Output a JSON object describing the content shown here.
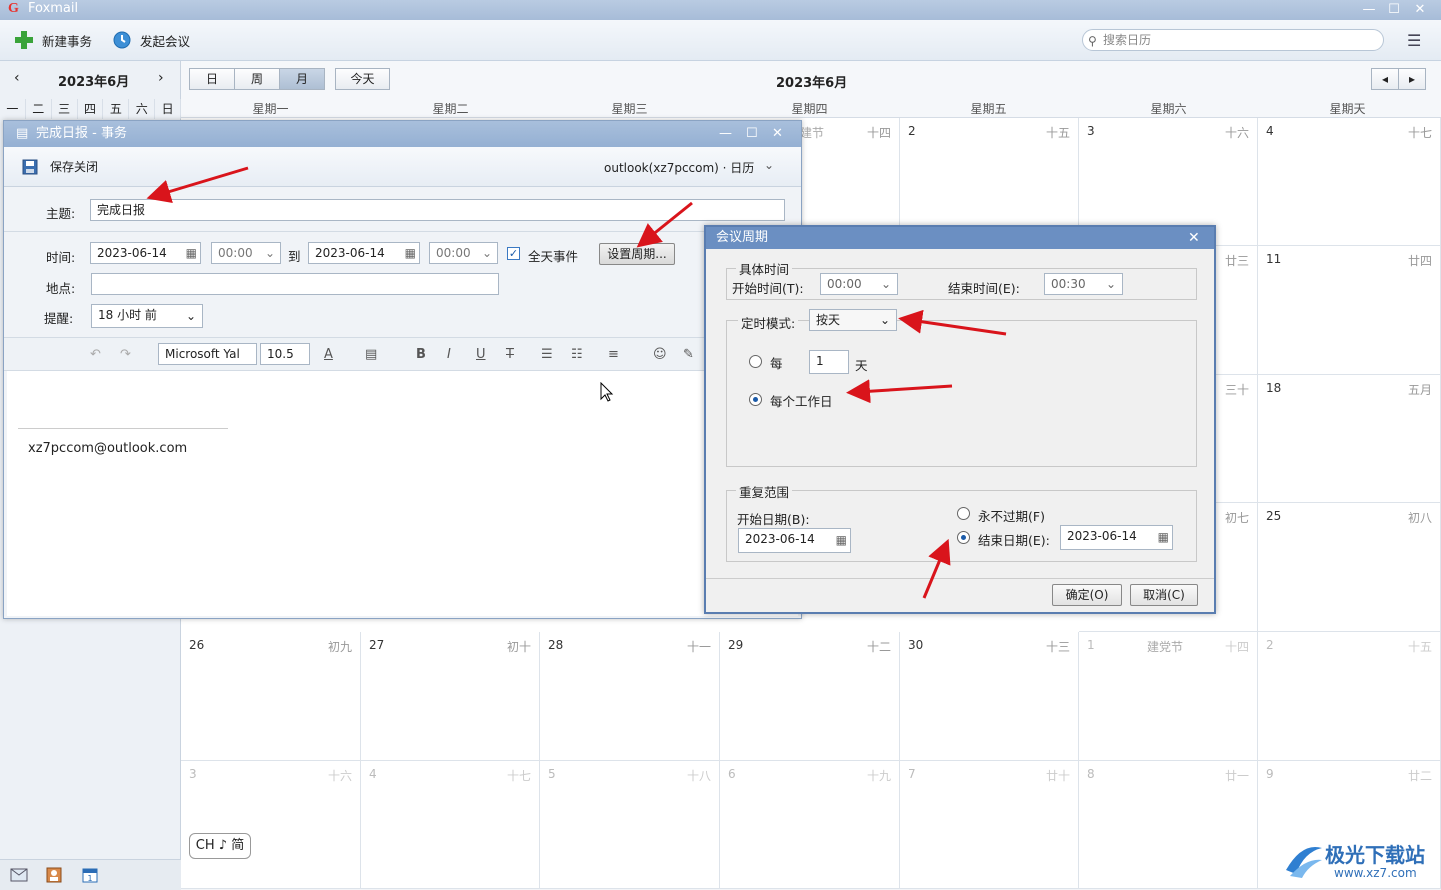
{
  "app": {
    "name": "Foxmail",
    "logo": "G"
  },
  "toolbar": {
    "new_event": "新建事务",
    "start_meeting": "发起会议",
    "search_placeholder": "搜索日历"
  },
  "sidebar": {
    "month": "2023年6月",
    "weekdays": [
      "一",
      "二",
      "三",
      "四",
      "五",
      "六",
      "日"
    ]
  },
  "view": {
    "day": "日",
    "week": "周",
    "month": "月",
    "today": "今天",
    "title": "2023年6月"
  },
  "dayheaders": [
    "星期一",
    "星期二",
    "星期三",
    "星期四",
    "星期五",
    "星期六",
    "星期天"
  ],
  "calendar": {
    "row0": [
      {
        "d": "",
        "l": "十四",
        "h": "建节"
      },
      {
        "d": "2",
        "l": "十五"
      },
      {
        "d": "3",
        "l": "十六"
      },
      {
        "d": "4",
        "l": "十七"
      }
    ],
    "row1": [
      {
        "d": "",
        "l": "廿三"
      },
      {
        "d": "11",
        "l": "廿四"
      }
    ],
    "row2": [
      {
        "d": "",
        "l": "三十"
      },
      {
        "d": "18",
        "l": "五月"
      }
    ],
    "row3": [
      {
        "d": "",
        "l": "初七"
      },
      {
        "d": "25",
        "l": "初八"
      }
    ],
    "row4": [
      {
        "d": "26",
        "l": "初九"
      },
      {
        "d": "27",
        "l": "初十"
      },
      {
        "d": "28",
        "l": "十一"
      },
      {
        "d": "29",
        "l": "十二"
      },
      {
        "d": "30",
        "l": "十三"
      },
      {
        "d": "1",
        "l": "十四",
        "h": "建党节"
      },
      {
        "d": "2",
        "l": "十五"
      }
    ],
    "row5": [
      {
        "d": "3",
        "l": "十六"
      },
      {
        "d": "4",
        "l": "十七"
      },
      {
        "d": "5",
        "l": "十八"
      },
      {
        "d": "6",
        "l": "十九"
      },
      {
        "d": "7",
        "l": "廿十"
      },
      {
        "d": "8",
        "l": "廿一"
      },
      {
        "d": "9",
        "l": "廿二"
      }
    ]
  },
  "ime": "CH ♪ 简",
  "event": {
    "title": "完成日报 - 事务",
    "save_close": "保存关闭",
    "account": "outlook(xz7pccom) · 日历",
    "subject_label": "主题:",
    "subject": "完成日报",
    "time_label": "时间:",
    "start_date": "2023-06-14",
    "start_time": "00:00",
    "to": "到",
    "end_date": "2023-06-14",
    "end_time": "00:00",
    "all_day": "全天事件",
    "set_recurrence": "设置周期...",
    "location_label": "地点:",
    "reminder_label": "提醒:",
    "reminder": "18 小时 前",
    "font": "Microsoft Yal",
    "size": "10.5",
    "signature": "xz7pccom@outlook.com"
  },
  "dialog": {
    "title": "会议周期",
    "specific_time": "具体时间",
    "start_time_label": "开始时间(T):",
    "start_time": "00:00",
    "end_time_label": "结束时间(E):",
    "end_time": "00:30",
    "mode_label": "定时模式:",
    "mode": "按天",
    "every": "每",
    "every_n": "1",
    "day_unit": "天",
    "every_workday": "每个工作日",
    "range": "重复范围",
    "start_date_label": "开始日期(B):",
    "start_date": "2023-06-14",
    "never_expire": "永不过期(F)",
    "end_date_label": "结束日期(E):",
    "end_date": "2023-06-14",
    "ok": "确定(O)",
    "cancel": "取消(C)"
  },
  "watermark": {
    "name": "极光下载站",
    "url": "www.xz7.com"
  },
  "colors": {
    "accent": "#1a5aa8",
    "title_blue": "#6b8fc2",
    "arrow_red": "#d9141b"
  }
}
